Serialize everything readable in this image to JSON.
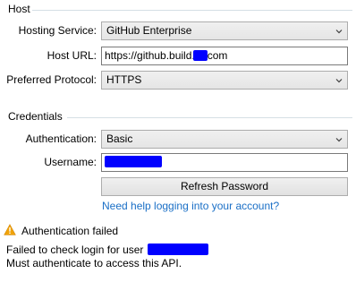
{
  "host": {
    "section_title": "Host",
    "hosting_service": {
      "label": "Hosting Service:",
      "value": "GitHub Enterprise"
    },
    "host_url": {
      "label": "Host URL:",
      "value_prefix": "https://github.build.",
      "value_suffix": "com"
    },
    "preferred_protocol": {
      "label": "Preferred Protocol:",
      "value": "HTTPS"
    }
  },
  "credentials": {
    "section_title": "Credentials",
    "authentication": {
      "label": "Authentication:",
      "value": "Basic"
    },
    "username": {
      "label": "Username:"
    },
    "refresh_button_label": "Refresh Password",
    "help_link": "Need help logging into your account?"
  },
  "status": {
    "title": "Authentication failed",
    "line1_prefix": "Failed to check login for user",
    "line2": "Must authenticate to access this API."
  },
  "colors": {
    "warning": "#f0a30a",
    "link": "#1a6fc6",
    "redaction": "#0000ff"
  },
  "icons": {
    "dropdown": "chevron-down-icon",
    "warning": "warning-icon"
  }
}
